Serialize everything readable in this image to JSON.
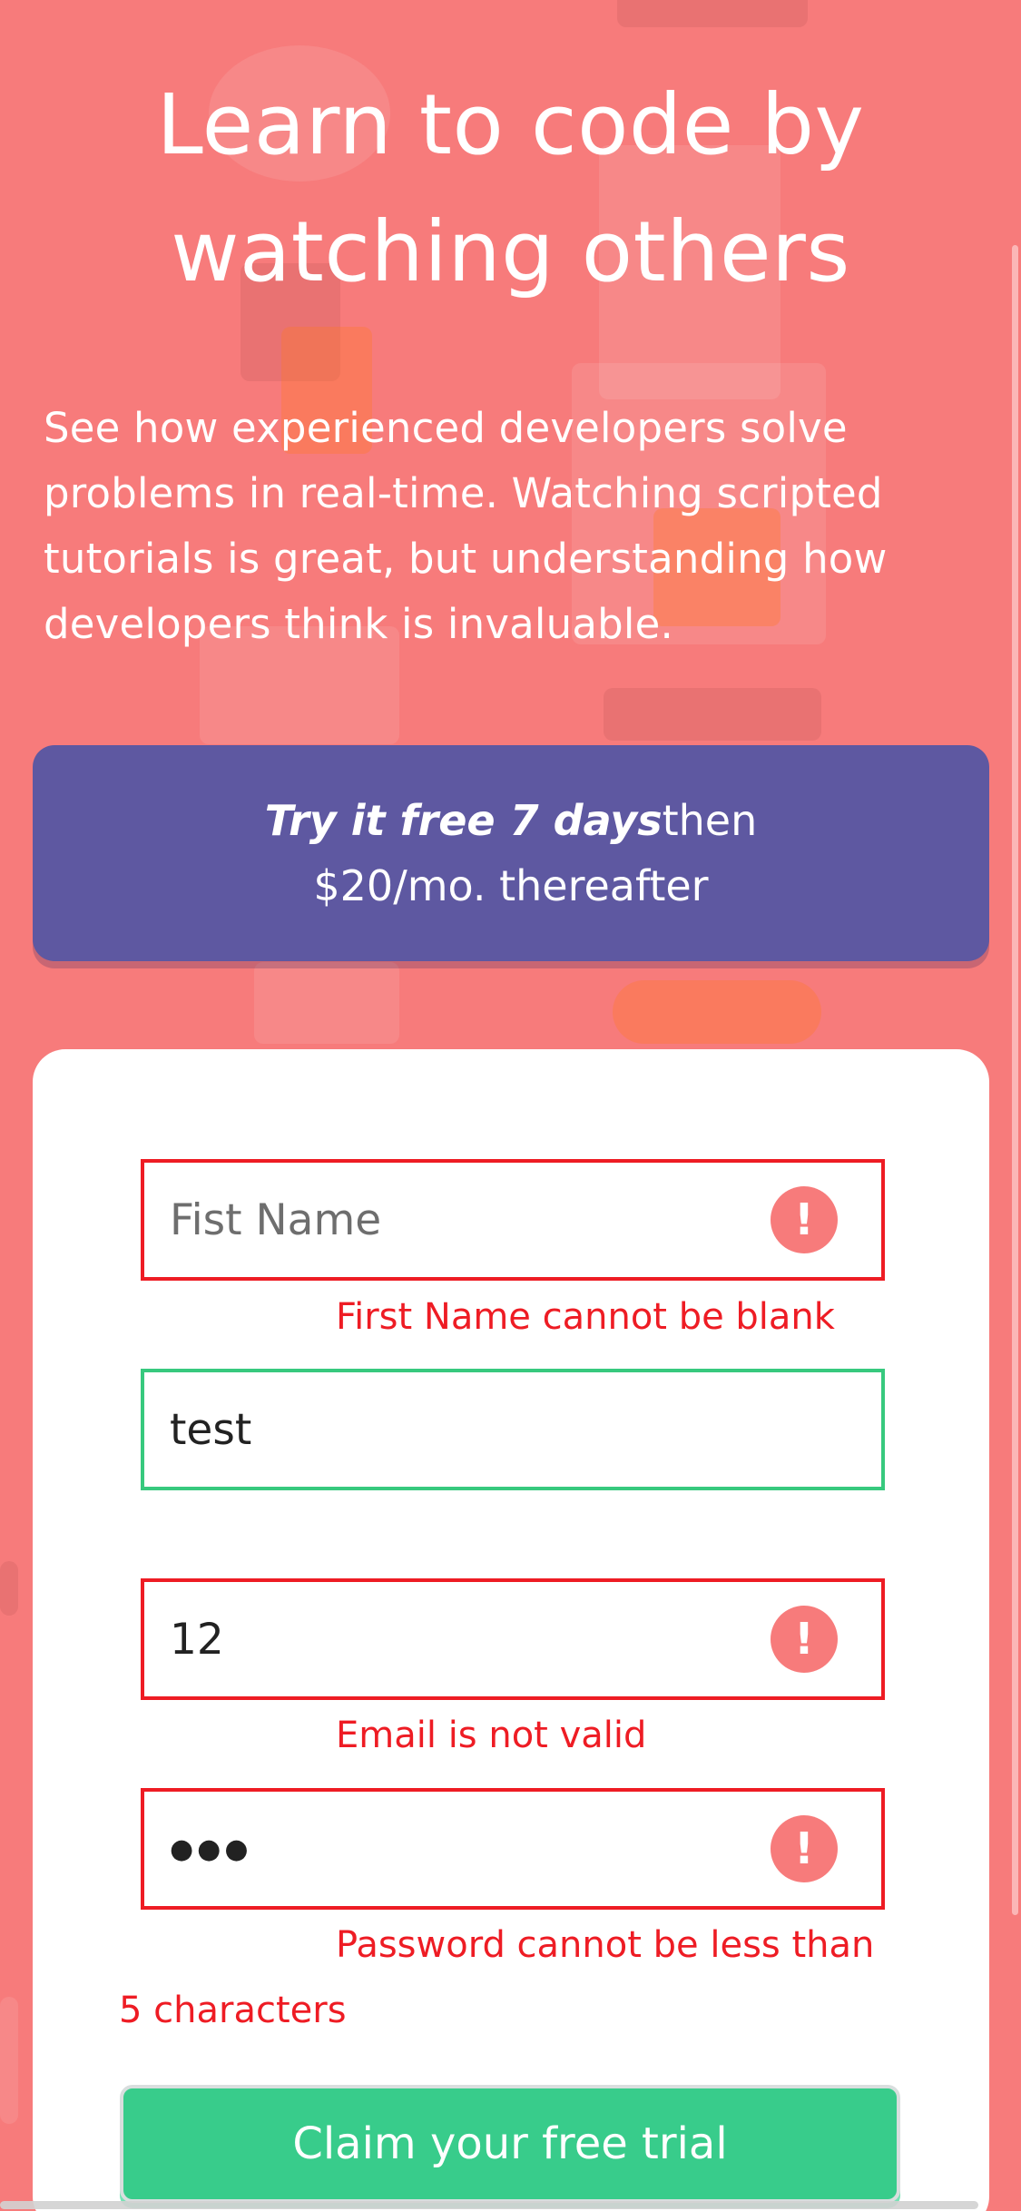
{
  "hero": {
    "title_line1": "Learn to code by",
    "title_line2": "watching others",
    "description": "See how experienced developers solve problems in real-time. Watching scripted tutorials is great, but understanding how developers think is invaluable."
  },
  "offer": {
    "trial_emphasis": "Try it free 7 days",
    "trial_suffix": "then",
    "price_line": "$20/mo. thereafter"
  },
  "form": {
    "first_name": {
      "value": "",
      "placeholder": "Fist Name",
      "status": "error",
      "error": "First Name cannot be blank"
    },
    "last_name": {
      "value": "test",
      "status": "valid"
    },
    "email": {
      "value": "12",
      "status": "error",
      "error": "Email is not valid"
    },
    "password": {
      "masked_value": "●●●",
      "status": "error",
      "error_line1": "Password cannot be less than",
      "error_line2": "5 characters"
    },
    "error_icon_glyph": "!",
    "submit_label": "Claim your free trial"
  },
  "colors": {
    "background": "#f77b7b",
    "banner": "#5e58a1",
    "error": "#ee1c24",
    "valid": "#37c97e",
    "submit": "#38cc8b"
  }
}
